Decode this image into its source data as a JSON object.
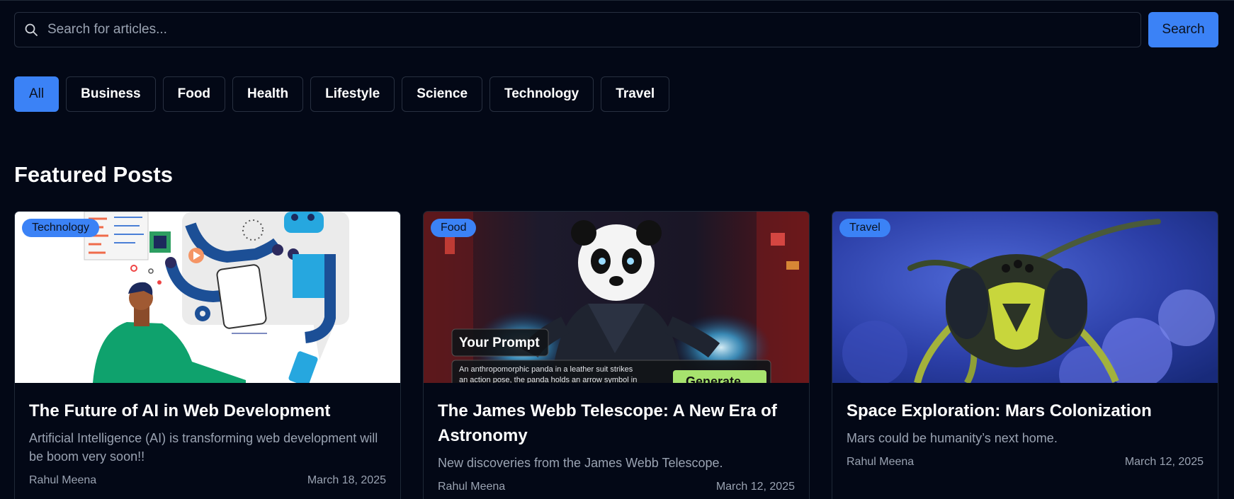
{
  "search": {
    "placeholder": "Search for articles...",
    "value": "",
    "button_label": "Search"
  },
  "categories": [
    {
      "label": "All",
      "active": true
    },
    {
      "label": "Business",
      "active": false
    },
    {
      "label": "Food",
      "active": false
    },
    {
      "label": "Health",
      "active": false
    },
    {
      "label": "Lifestyle",
      "active": false
    },
    {
      "label": "Science",
      "active": false
    },
    {
      "label": "Technology",
      "active": false
    },
    {
      "label": "Travel",
      "active": false
    }
  ],
  "section_title": "Featured Posts",
  "posts": [
    {
      "category": "Technology",
      "title": "The Future of AI in Web Development",
      "description": "Artificial Intelligence (AI) is transforming web development will be boom very soon!!",
      "author": "Rahul Meena",
      "date": "March 18, 2025",
      "image": "illustration-person-with-robot-arms"
    },
    {
      "category": "Food",
      "title": "The James Webb Telescope: A New Era of Astronomy",
      "description": "New discoveries from the James Webb Telescope.",
      "author": "Rahul Meena",
      "date": "March 12, 2025",
      "image": "panda-in-leather-suit",
      "image_text": {
        "prompt_label": "Your Prompt",
        "prompt_text_line1": "An anthropomorphic panda in a leather suit strikes",
        "prompt_text_line2": "an action pose, the panda holds an arrow symbol in",
        "button": "Generate"
      }
    },
    {
      "category": "Travel",
      "title": "Space Exploration: Mars Colonization",
      "description": "Mars could be humanity’s next home.",
      "author": "Rahul Meena",
      "date": "March 12, 2025",
      "image": "wasp-macro-photo"
    }
  ],
  "colors": {
    "background": "#030816",
    "accent": "#3b82f6",
    "border": "#283040",
    "muted_text": "#9aa3b2"
  }
}
